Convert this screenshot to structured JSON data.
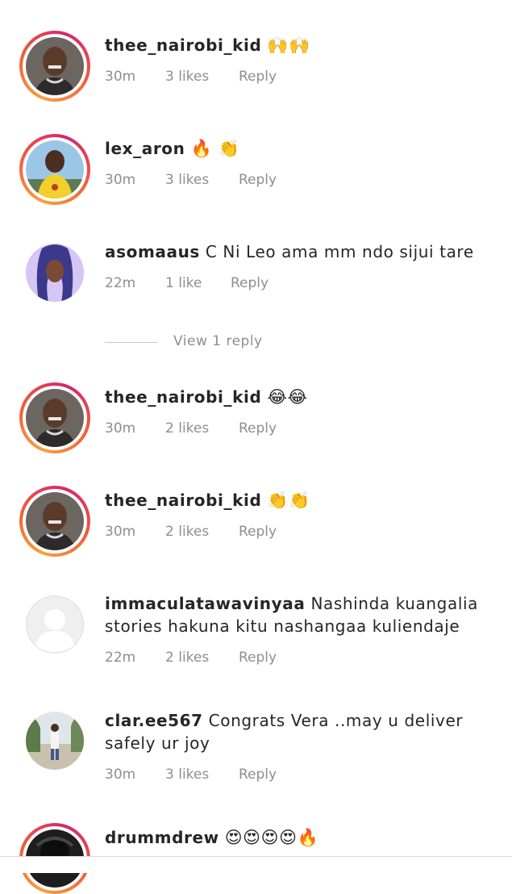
{
  "comments": [
    {
      "username": "thee_nairobi_kid",
      "text": "",
      "emoji": "🙌🙌",
      "time": "30m",
      "likes": "3 likes",
      "reply": "Reply",
      "ring": true,
      "avatar": "woman-grills"
    },
    {
      "username": "lex_aron",
      "text": "",
      "emoji": "🔥 👏",
      "time": "30m",
      "likes": "3 likes",
      "reply": "Reply",
      "ring": true,
      "avatar": "man-yellow-shirt"
    },
    {
      "username": "asomaaus",
      "text": "C Ni Leo ama mm ndo sijui tare",
      "emoji": "",
      "time": "22m",
      "likes": "1 like",
      "reply": "Reply",
      "ring": false,
      "avatar": "purple-hair"
    },
    {
      "username": "thee_nairobi_kid",
      "text": "",
      "emoji": "😂😂",
      "time": "30m",
      "likes": "2 likes",
      "reply": "Reply",
      "ring": true,
      "avatar": "woman-grills"
    },
    {
      "username": "thee_nairobi_kid",
      "text": "",
      "emoji": "👏👏",
      "time": "30m",
      "likes": "2 likes",
      "reply": "Reply",
      "ring": true,
      "avatar": "woman-grills"
    },
    {
      "username": "immaculatawavinyaa",
      "text": "Nashinda kuangalia stories hakuna kitu nashangaa kuliendaje",
      "emoji": "",
      "time": "22m",
      "likes": "2 likes",
      "reply": "Reply",
      "ring": false,
      "avatar": "default-user"
    },
    {
      "username": "clar.ee567",
      "text": "Congrats Vera ..may u deliver safely ur joy",
      "emoji": "",
      "time": "30m",
      "likes": "3 likes",
      "reply": "Reply",
      "ring": false,
      "avatar": "person-outdoors"
    },
    {
      "username": "drummdrew",
      "text": "",
      "emoji": "😍😍😍😍🔥",
      "ring": true,
      "avatar": "dark-portrait"
    }
  ],
  "view_replies": {
    "label": "View 1 reply"
  }
}
